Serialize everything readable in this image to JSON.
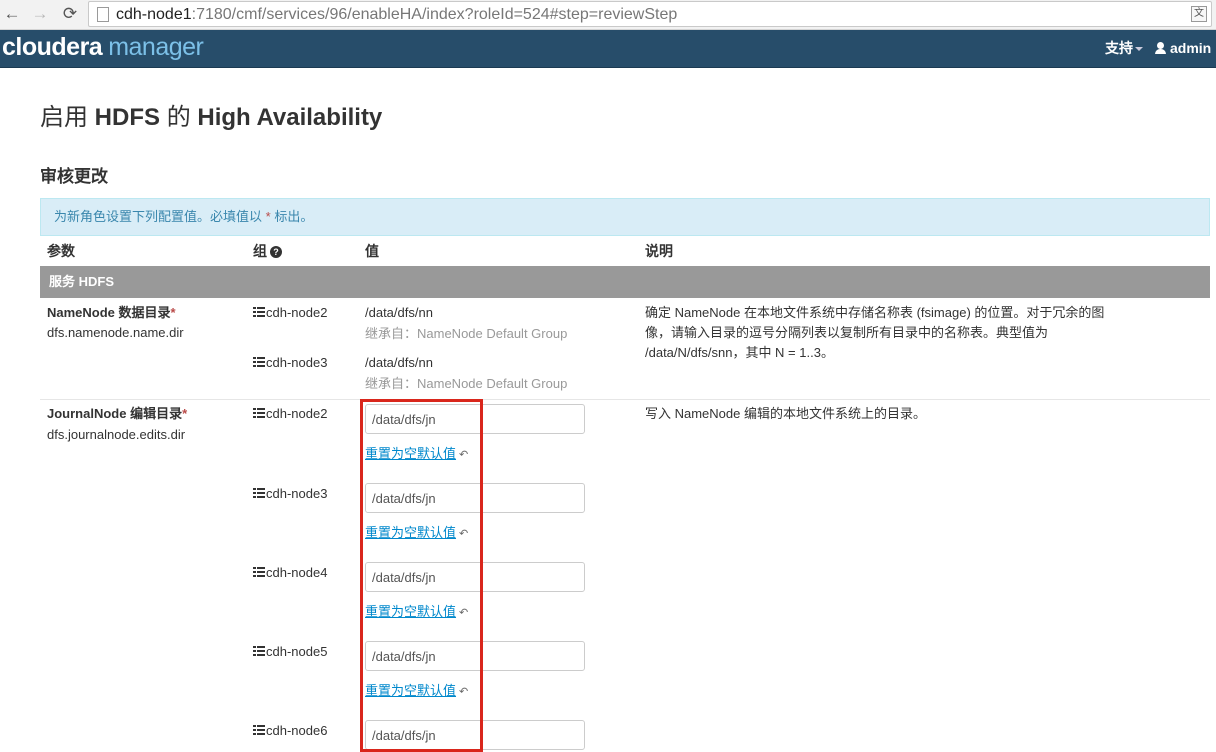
{
  "browser": {
    "url_host": "cdh-node1",
    "url_rest": ":7180/cmf/services/96/enableHA/index?roleId=524#step=reviewStep"
  },
  "header": {
    "logo_part1": "cloudera",
    "logo_part2": "manager",
    "support_menu": "支持",
    "user_menu": "admin"
  },
  "page": {
    "title_prefix": "启用",
    "title_service": "HDFS",
    "title_mid": "的",
    "title_suffix": "High Availability",
    "section_title": "审核更改",
    "banner_text": "为新角色设置下列配置值。必填值以",
    "banner_star": "*",
    "banner_suffix": "标出。"
  },
  "table": {
    "headers": {
      "param": "参数",
      "group": "组",
      "value": "值",
      "desc": "说明"
    },
    "service_row": "服务 HDFS",
    "rows": [
      {
        "name": "NameNode 数据目录",
        "key": "dfs.namenode.name.dir",
        "description": "确定 NameNode 在本地文件系统中存储名称表 (fsimage) 的位置。对于冗余的图像，请输入目录的逗号分隔列表以复制所有目录中的名称表。典型值为 /data/N/dfs/snn，其中 N = 1..3。",
        "entries": [
          {
            "group": "cdh-node2",
            "value": "/data/dfs/nn",
            "inherited": "继承自：NameNode Default Group"
          },
          {
            "group": "cdh-node3",
            "value": "/data/dfs/nn",
            "inherited": "继承自：NameNode Default Group"
          }
        ]
      },
      {
        "name": "JournalNode 编辑目录",
        "key": "dfs.journalnode.edits.dir",
        "description": "写入 NameNode 编辑的本地文件系统上的目录。",
        "reset_label": "重置为空默认值",
        "entries": [
          {
            "group": "cdh-node2",
            "value": "/data/dfs/jn"
          },
          {
            "group": "cdh-node3",
            "value": "/data/dfs/jn"
          },
          {
            "group": "cdh-node4",
            "value": "/data/dfs/jn"
          },
          {
            "group": "cdh-node5",
            "value": "/data/dfs/jn"
          },
          {
            "group": "cdh-node6",
            "value": "/data/dfs/jn"
          }
        ]
      }
    ]
  },
  "colors": {
    "header_bg": "#274d6a",
    "logo_accent": "#7cc0e8",
    "banner_bg": "#d9edf7",
    "service_row_bg": "#999999",
    "highlight": "#d9261c",
    "link": "#0088cc"
  }
}
